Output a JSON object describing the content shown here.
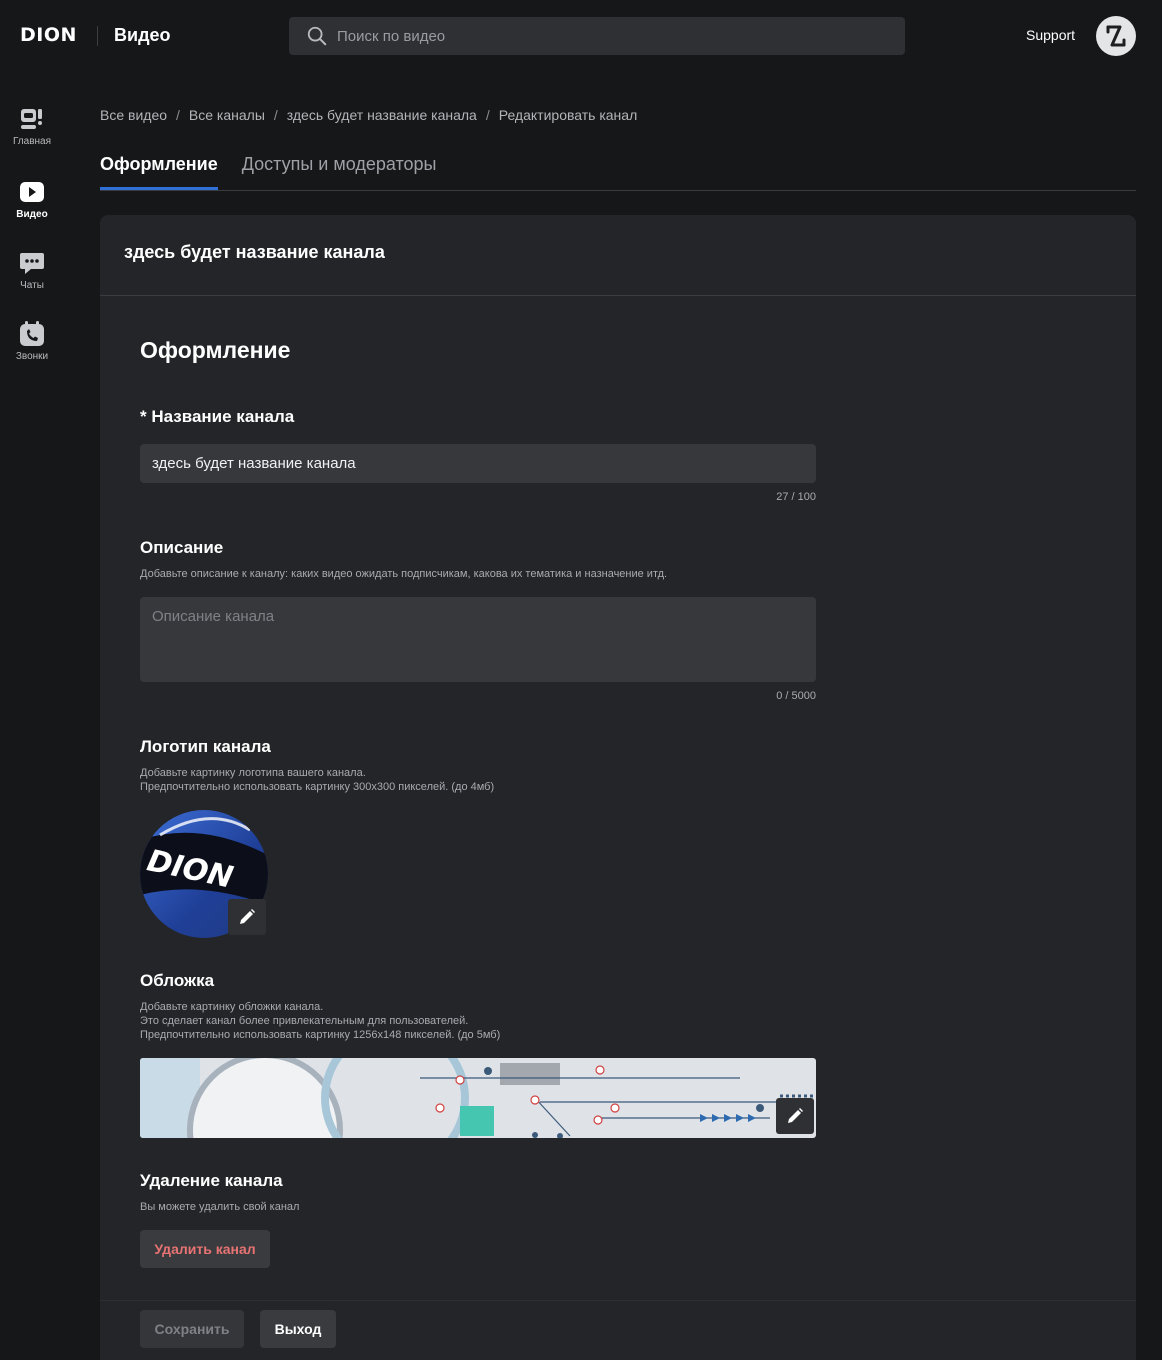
{
  "header": {
    "logo": "DION",
    "app_title": "Видео",
    "search_placeholder": "Поиск по видео",
    "support_label": "Support"
  },
  "sidebar": {
    "items": [
      {
        "label": "Главная",
        "icon": "home-icon"
      },
      {
        "label": "Видео",
        "icon": "video-icon",
        "active": true
      },
      {
        "label": "Чаты",
        "icon": "chat-icon"
      },
      {
        "label": "Звонки",
        "icon": "calls-icon"
      }
    ]
  },
  "breadcrumb": [
    "Все видео",
    "Все каналы",
    "здесь будет название канала",
    "Редактировать канал"
  ],
  "tabs": [
    {
      "label": "Оформление",
      "active": true
    },
    {
      "label": "Доступы и модераторы"
    }
  ],
  "card": {
    "title": "здесь будет название канала",
    "section_title": "Оформление",
    "name_field": {
      "label": "* Название канала",
      "value": "здесь будет название канала",
      "counter": "27 / 100"
    },
    "description_field": {
      "label": "Описание",
      "hint": "Добавьте описание к каналу: каких видео ожидать подписчикам, какова их тематика и назначение итд.",
      "placeholder": "Описание канала",
      "counter": "0 / 5000"
    },
    "logo_field": {
      "label": "Логотип канала",
      "hint_1": "Добавьте картинку логотипа вашего канала.",
      "hint_2": "Предпочтительно использовать картинку 300x300 пикселей. (до 4мб)",
      "logo_text": "DION"
    },
    "cover_field": {
      "label": "Обложка",
      "hint_1": "Добавьте картинку обложки канала.",
      "hint_2": "Это сделает канал более привлекательным для пользователей.",
      "hint_3": "Предпочтительно использовать картинку 1256x148 пикселей. (до 5мб)"
    },
    "delete_section": {
      "label": "Удаление канала",
      "hint": "Вы можете удалить свой канал",
      "button": "Удалить канал"
    }
  },
  "footer": {
    "save_label": "Сохранить",
    "exit_label": "Выход"
  },
  "colors": {
    "accent": "#2f6fd6",
    "danger": "#e77373",
    "background": "#161719",
    "card": "#242528"
  }
}
